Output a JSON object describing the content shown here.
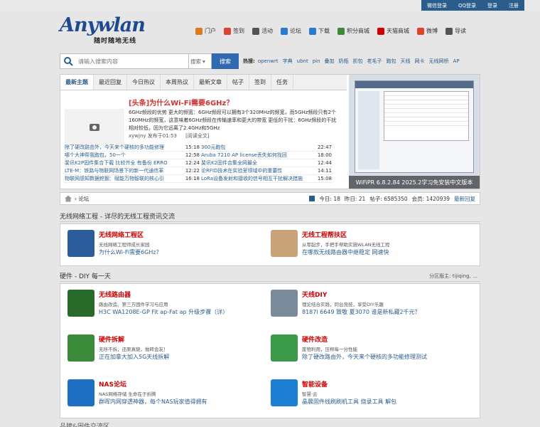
{
  "topbar": {
    "items": [
      "微信登录",
      "QQ登录",
      "登录",
      "注册"
    ]
  },
  "logo": {
    "brand": "Anywlan",
    "slogan": "随时随地无线"
  },
  "nav": {
    "items": [
      {
        "label": "门户",
        "icon": "rss-icon",
        "color": "#e07b1a"
      },
      {
        "label": "签到",
        "icon": "signin-icon",
        "color": "#d9452b"
      },
      {
        "label": "活动",
        "icon": "antenna-icon",
        "color": "#555555"
      },
      {
        "label": "论坛",
        "icon": "forum-icon",
        "color": "#2b7bd1"
      },
      {
        "label": "下载",
        "icon": "download-icon",
        "color": "#2b7bd1"
      },
      {
        "label": "积分商城",
        "icon": "cart-icon",
        "color": "#3a8a3a"
      },
      {
        "label": "天猫商城",
        "icon": "tmall-icon",
        "color": "#d00000"
      },
      {
        "label": "微博",
        "icon": "weibo-icon",
        "color": "#e0442b"
      },
      {
        "label": "导读",
        "icon": "guide-icon",
        "color": "#555555"
      }
    ]
  },
  "search": {
    "placeholder": "请输入搜索内容",
    "type": "搜索",
    "button": "搜索",
    "hot_label": "热搜:",
    "hot": [
      "openwrt",
      "字典",
      "ubnt",
      "pin",
      "叠加",
      "奶瓶",
      "抓包",
      "老毛子",
      "跑包",
      "天线",
      "网卡",
      "无线网桥",
      "AP"
    ]
  },
  "tabs": [
    "最新主题",
    "最近回复",
    "今日热议",
    "本周热议",
    "最新文章",
    "帖子",
    "签到",
    "任务"
  ],
  "headline": "[头条]为什么Wi-Fi需要6GHz？",
  "lead": "6GHz频段的优势 更大的频宽：6GHz频段可以拥有3个320MHz的频宽，而5GHz频段只有2个160MHz的频宽，这意味着6GHz频段在传输速率和更大的带宽 更低的干扰：6GHz频段的干扰相对较低，因为它远离了2.4GHz和5GHz",
  "meta": {
    "author": "xywjny 发布于01:53",
    "read": "[阅读全文]"
  },
  "news_left": [
    {
      "title": "除了硬改路由外，今天来个硬核的多功能修理",
      "time": "15:18"
    },
    {
      "title": "哪个大神帮我跑包，50一个",
      "time": "12:58"
    },
    {
      "title": "斐讯K2P固件集合下载 比较齐全 有备份 ERRO",
      "time": "12:24"
    },
    {
      "title": "LTE-M：铁路与物联网场景下的新一代通信革",
      "time": "12:22"
    },
    {
      "title": "物联网感知数据挖掘：赋能万物智联的核心引",
      "time": "16:18"
    }
  ],
  "news_right": [
    {
      "title": "300元跑包",
      "time": "22:47"
    },
    {
      "title": "Aruba 7210 AP license丢失如何找回",
      "time": "18:00"
    },
    {
      "title": "斐讯K2固件合集全网最全",
      "time": "12:44"
    },
    {
      "title": "论RFID技术在实验室领域中的重要性",
      "time": "14:11"
    },
    {
      "title": "LoRa设备发射和接收的信号相互干扰解决措施",
      "time": "15:08"
    }
  ],
  "feature_caption": "WiFiPR 6.8.2.84 2025.2学习免安装中文版本",
  "crumb": {
    "home": "首页",
    "current": "论坛",
    "stats": [
      "今日: 18",
      "昨日: 21",
      "帖子: 6585350",
      "会员: 1420939",
      "最新回复"
    ]
  },
  "sections": [
    {
      "title": "无线网络工程 - 详尽的无线工程资讯交流",
      "moderators": "",
      "forums": [
        {
          "name": "无线网络工程区",
          "desc": "无线网络工程师成长家园",
          "latest": "为什么Wi-Fi需要6GHz？",
          "color": "#2b5d9c"
        },
        {
          "name": "无线工程帮扶区",
          "desc": "从零起步，手把手帮助实施WLAN无线工程",
          "latest": "在哪款无线路由器中继稳定 网速快",
          "color": "#c9a37a"
        }
      ]
    },
    {
      "title": "硬件 - DIY 每一天",
      "moderators": "分区版主: tijiqing,  …",
      "forums": [
        {
          "name": "无线路由器",
          "desc": "路由改造、第三方固件学习与应用",
          "latest": "H3C WA1208E-GP Fit ap-Fat ap 升级步骤（详）",
          "color": "#2a6a2a"
        },
        {
          "name": "天线DIY",
          "desc": "理论结合实践，同台竞技，享受DIY乐趣",
          "latest": "8187l 6649 致敬 夏3070 谁是新私藏2千元？",
          "color": "#7a8a9a"
        },
        {
          "name": "硬件拆解",
          "desc": "无所不拆，还原真貌，抛砖会友！",
          "latest": "正在加拿大加入5G天线拆解",
          "color": "#3a8a3a"
        },
        {
          "name": "硬件改造",
          "desc": "废物利用，压榨每一分性能",
          "latest": "除了硬改路由外，今天来个硬核的多功能修理测试",
          "color": "#3a9a4a"
        },
        {
          "name": "NAS论坛",
          "desc": "NAS网络存储 生命在于折腾",
          "latest": "群晖内网穿透神器，每个NAS玩家值得拥有",
          "color": "#1d6fc4"
        },
        {
          "name": "智能设备",
          "desc": "智慧·云",
          "latest": "晶晨固件线刷刷机工具 烧录工具 解包",
          "color": "#1d7fd4"
        }
      ]
    }
  ],
  "bottom_head": "品牌&固件交流区"
}
